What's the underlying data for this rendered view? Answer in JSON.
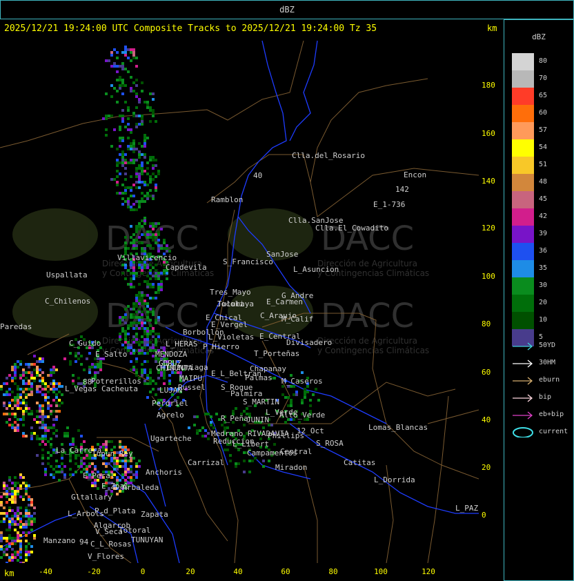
{
  "window": {
    "title": "dBZ"
  },
  "header": {
    "text": "2025/12/21 19:24:00 UTC Composite Tracks to 2025/12/21 19:24:00 Tz 35",
    "km_label": "km"
  },
  "axes": {
    "x_label": "km",
    "x_ticks": [
      "-40",
      "-20",
      "0",
      "20",
      "40",
      "60",
      "80",
      "100",
      "120"
    ],
    "y_ticks": [
      "180",
      "160",
      "140",
      "120",
      "100",
      "80",
      "60",
      "40",
      "20",
      "0"
    ]
  },
  "legend": {
    "title": "dBZ",
    "levels": [
      {
        "label": "80",
        "color": "#d4d4d4"
      },
      {
        "label": "70",
        "color": "#b8b8b8"
      },
      {
        "label": "65",
        "color": "#ff3c28"
      },
      {
        "label": "60",
        "color": "#ff6e0a"
      },
      {
        "label": "57",
        "color": "#ff9a5a"
      },
      {
        "label": "54",
        "color": "#ffff00"
      },
      {
        "label": "51",
        "color": "#f8c828"
      },
      {
        "label": "48",
        "color": "#d2873c"
      },
      {
        "label": "45",
        "color": "#c8647e"
      },
      {
        "label": "42",
        "color": "#d21e8c"
      },
      {
        "label": "39",
        "color": "#7814c8"
      },
      {
        "label": "36",
        "color": "#1e50f0"
      },
      {
        "label": "35",
        "color": "#1e8ce6"
      },
      {
        "label": "30",
        "color": "#0a8c1e"
      },
      {
        "label": "20",
        "color": "#006e0a"
      },
      {
        "label": "10",
        "color": "#005000"
      },
      {
        "label": "5",
        "color": "#483c8c"
      }
    ]
  },
  "tracks": [
    {
      "label": "50YD",
      "color": "#3fd0d8"
    },
    {
      "label": "30HM",
      "color": "#ffffff"
    },
    {
      "label": "eburn",
      "color": "#d8b070"
    },
    {
      "label": "bip",
      "color": "#ffd8e0"
    },
    {
      "label": "eb+bip",
      "color": "#e040c8"
    },
    {
      "label": "current",
      "color": "#3fe0e8"
    }
  ],
  "watermark": {
    "name": "DACC",
    "line1": "Dirección de Agricultura",
    "line2": "y Contingencias Climáticas"
  },
  "places": [
    "Clla.del_Rosario",
    "Encon",
    "Ramblon",
    "142",
    "E_1-736",
    "Clla.SanJose",
    "Clla.El_Cowadito",
    "Uspallata",
    "Villavicencio",
    "Capdevila",
    "S_Francisco",
    "SanJose",
    "L_Asuncion",
    "C_Chilenos",
    "Tres_Mayo",
    "Jocoli",
    "Tulumaya",
    "E_Carmen",
    "G_Andre",
    "Paredas",
    "E_Chical",
    "E_Vergel",
    "C_Araujo",
    "M_Calif",
    "Borbollon",
    "L_Violetas",
    "E_Central",
    "Divisadero",
    "C_Guido",
    "L_HERAS",
    "P_Hierro",
    "E_Salto",
    "MENDOZA",
    "T_Porteñas",
    "GDRUZ",
    "Luzuriaga",
    "Chapanay",
    "Potrerillos",
    "MAIPU",
    "E_L_Beltran",
    "Palmas",
    "M_Caseros",
    "L_Vegas",
    "Cacheuta",
    "LUJAN",
    "Russel",
    "S_Roque",
    "Palmira",
    "Perdriel",
    "S_MARTIN",
    "L_Verde",
    "Alto_Verde",
    "Agrelo",
    "R_Peña",
    "JUNIN",
    "Ugarteche",
    "Medrano",
    "RIVADAVIA",
    "12_Oct",
    "Phillips",
    "Lomas_Blancas",
    "S_ROSA",
    "La_Carrera",
    "Tupun_Rey",
    "Reduccion",
    "L_Libert",
    "Campamentos",
    "Central",
    "Carrizal",
    "Catitas",
    "E_Peral",
    "Anchoris",
    "Miradon",
    "L_Dorrida",
    "E_Zpal",
    "G.Arbaleda",
    "Gltallary",
    "P_d_Plata",
    "Zapata",
    "L_PAZ",
    "L_Arbols",
    "Algarrob",
    "Totoral",
    "V_Seca",
    "TUNUYAN",
    "Manzano",
    "C_L_Rosas",
    "V_Flores",
    "CHIMUNTA",
    "40",
    "88",
    "94"
  ]
}
